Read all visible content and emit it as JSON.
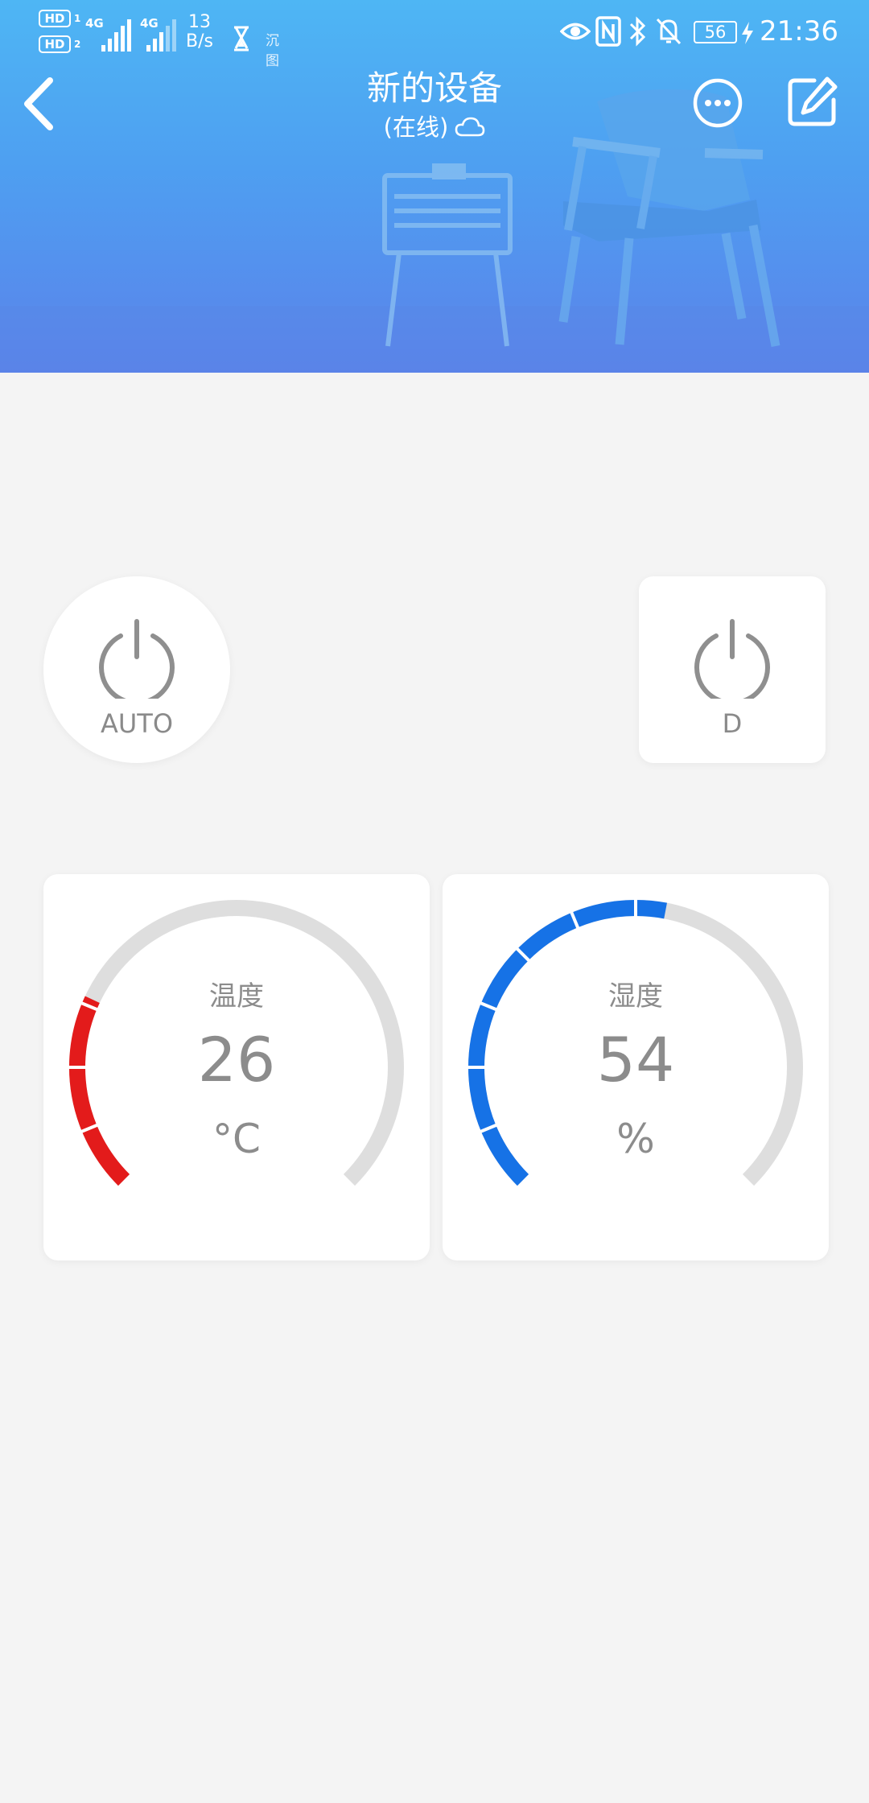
{
  "status_bar": {
    "sim1_badge": "HD",
    "sim1_num": "1",
    "sim2_badge": "HD",
    "sim2_num": "2",
    "net1": "4G",
    "net2": "4G",
    "speed_value": "13",
    "speed_unit": "B/s",
    "app_tag": "沉图",
    "battery": "56",
    "time": "21:36",
    "icons": [
      "eye-icon",
      "nfc-icon",
      "bluetooth-icon",
      "mute-bell-icon",
      "charging-icon"
    ]
  },
  "header": {
    "title": "新的设备",
    "subtitle": "(在线)",
    "status_icon": "cloud-icon"
  },
  "power_buttons": [
    {
      "label": "AUTO",
      "shape": "round"
    },
    {
      "label": "D",
      "shape": "square"
    }
  ],
  "gauges": [
    {
      "label": "温度",
      "value": "26",
      "unit": "°C",
      "fraction": 0.26,
      "color": "#e31b1b"
    },
    {
      "label": "湿度",
      "value": "54",
      "unit": "%",
      "fraction": 0.54,
      "color": "#1672e6"
    }
  ],
  "colors": {
    "header_gradient_top": "#4eb6f4",
    "header_gradient_bottom": "#5b82ea",
    "background": "#f4f4f4",
    "track": "#dedede",
    "temperature": "#e31b1b",
    "humidity": "#1672e6"
  }
}
